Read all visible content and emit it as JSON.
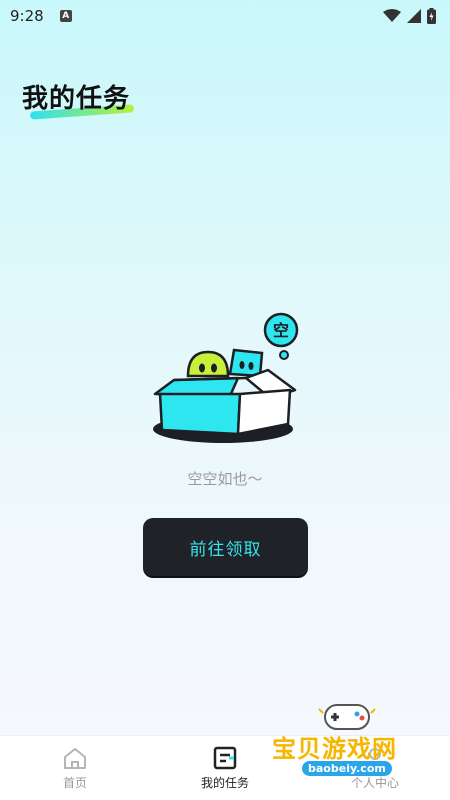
{
  "status_bar": {
    "time": "9:28",
    "badge": "A"
  },
  "page_title": "我的任务",
  "empty_state": {
    "bubble_char": "空",
    "message": "空空如也～",
    "button_label": "前往领取"
  },
  "bottom_nav": {
    "items": [
      {
        "label": "首页",
        "icon": "home-icon",
        "active": false
      },
      {
        "label": "我的任务",
        "icon": "task-icon",
        "active": true
      },
      {
        "label": "个人中心",
        "icon": "profile-icon",
        "active": false
      }
    ]
  },
  "watermark": {
    "main": "宝贝游戏网",
    "sub": "baobeiy.com"
  },
  "colors": {
    "accent_cyan": "#35e4ee",
    "button_dark": "#1f2226",
    "box_cyan": "#2ee6f0",
    "lime": "#c8f03a"
  }
}
